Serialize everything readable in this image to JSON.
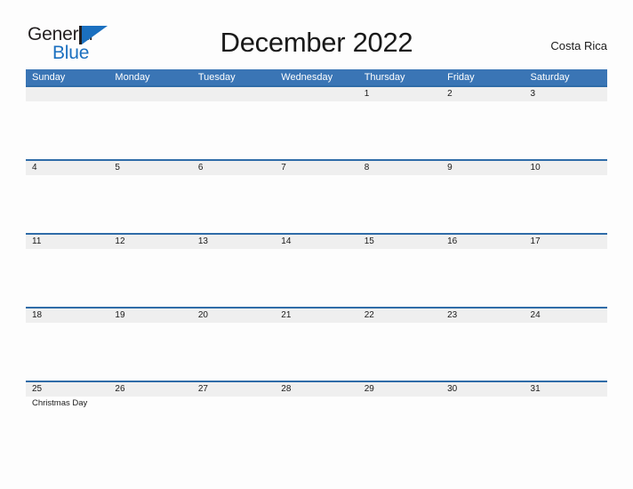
{
  "brand": {
    "name_part1": "General",
    "name_part2": "Blue",
    "mark": "triangle-flag-mark"
  },
  "header": {
    "title": "December 2022",
    "locale": "Costa Rica"
  },
  "colors": {
    "header_blue": "#3a75b5",
    "row_divider_blue": "#2f6ca8",
    "date_band_gray": "#efefef",
    "brand_blue": "#1b70c0",
    "page_background": "#fdfdfd",
    "text": "#1a1a1a"
  },
  "calendar": {
    "weekdays": [
      "Sunday",
      "Monday",
      "Tuesday",
      "Wednesday",
      "Thursday",
      "Friday",
      "Saturday"
    ],
    "weeks": [
      {
        "days": [
          {
            "num": "",
            "event": ""
          },
          {
            "num": "",
            "event": ""
          },
          {
            "num": "",
            "event": ""
          },
          {
            "num": "",
            "event": ""
          },
          {
            "num": "1",
            "event": ""
          },
          {
            "num": "2",
            "event": ""
          },
          {
            "num": "3",
            "event": ""
          }
        ]
      },
      {
        "days": [
          {
            "num": "4",
            "event": ""
          },
          {
            "num": "5",
            "event": ""
          },
          {
            "num": "6",
            "event": ""
          },
          {
            "num": "7",
            "event": ""
          },
          {
            "num": "8",
            "event": ""
          },
          {
            "num": "9",
            "event": ""
          },
          {
            "num": "10",
            "event": ""
          }
        ]
      },
      {
        "days": [
          {
            "num": "11",
            "event": ""
          },
          {
            "num": "12",
            "event": ""
          },
          {
            "num": "13",
            "event": ""
          },
          {
            "num": "14",
            "event": ""
          },
          {
            "num": "15",
            "event": ""
          },
          {
            "num": "16",
            "event": ""
          },
          {
            "num": "17",
            "event": ""
          }
        ]
      },
      {
        "days": [
          {
            "num": "18",
            "event": ""
          },
          {
            "num": "19",
            "event": ""
          },
          {
            "num": "20",
            "event": ""
          },
          {
            "num": "21",
            "event": ""
          },
          {
            "num": "22",
            "event": ""
          },
          {
            "num": "23",
            "event": ""
          },
          {
            "num": "24",
            "event": ""
          }
        ]
      },
      {
        "days": [
          {
            "num": "25",
            "event": "Christmas Day"
          },
          {
            "num": "26",
            "event": ""
          },
          {
            "num": "27",
            "event": ""
          },
          {
            "num": "28",
            "event": ""
          },
          {
            "num": "29",
            "event": ""
          },
          {
            "num": "30",
            "event": ""
          },
          {
            "num": "31",
            "event": ""
          }
        ]
      }
    ]
  }
}
